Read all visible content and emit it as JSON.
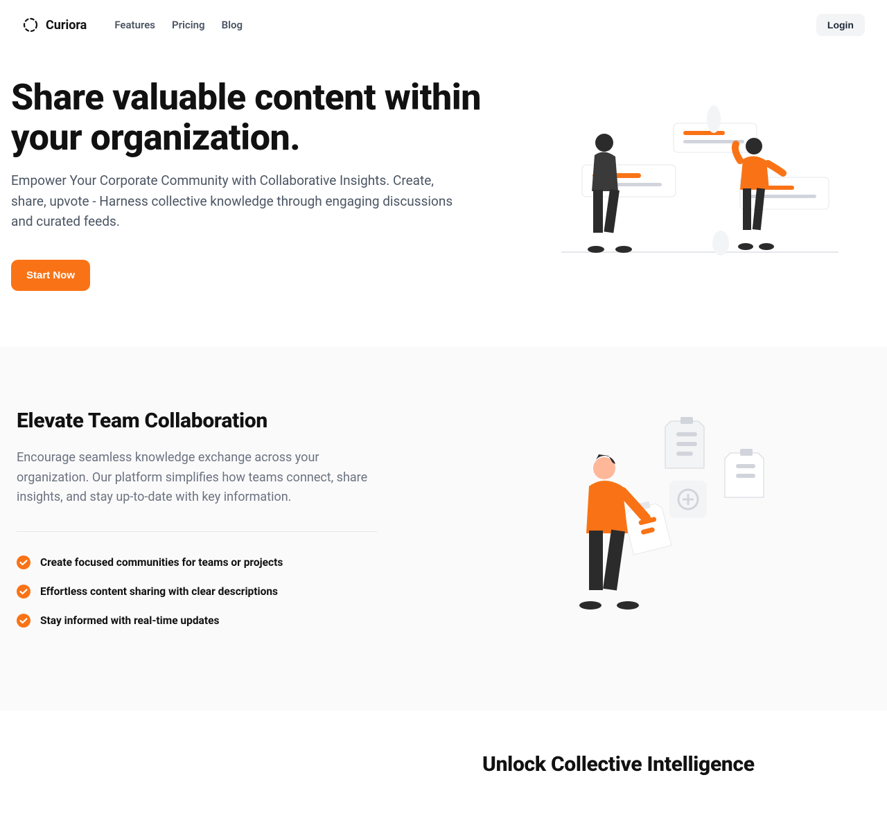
{
  "brand": {
    "name": "Curiora"
  },
  "nav": {
    "links": [
      {
        "label": "Features"
      },
      {
        "label": "Pricing"
      },
      {
        "label": "Blog"
      }
    ],
    "login": "Login"
  },
  "hero": {
    "title": "Share valuable content within your organization.",
    "subtitle": "Empower Your Corporate Community with Collaborative Insights. Create, share, upvote - Harness collective knowledge through engaging discussions and curated feeds.",
    "cta": "Start Now"
  },
  "section2": {
    "title": "Elevate Team Collaboration",
    "subtitle": "Encourage seamless knowledge exchange across your organization. Our platform simplifies how teams connect, share insights, and stay up-to-date with key information.",
    "features": [
      "Create focused communities for teams or projects",
      "Effortless content sharing with clear descriptions",
      "Stay informed with real-time updates"
    ]
  },
  "section3": {
    "title": "Unlock Collective Intelligence"
  },
  "colors": {
    "accent": "#f97316",
    "text_muted": "#4b5563"
  }
}
